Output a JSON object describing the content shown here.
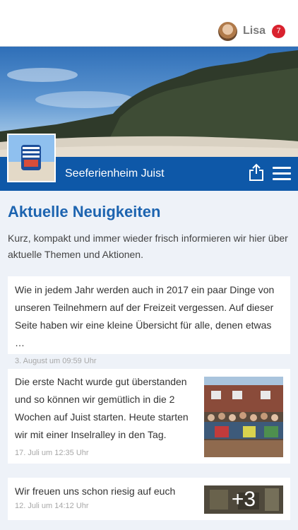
{
  "header": {
    "username": "Lisa",
    "notification_count": "7"
  },
  "site": {
    "name": "Seeferienheim Juist"
  },
  "main": {
    "section_title": "Aktuelle Neuigkeiten",
    "intro": "Kurz, kompakt und immer wieder frisch informieren wir hier über aktuelle Themen und Aktionen."
  },
  "posts": [
    {
      "text": "Wie in jedem Jahr werden auch in 2017 ein paar Dinge von unseren Teilnehmern auf der Freizeit vergessen. Auf dieser Seite haben wir eine kleine Übersicht für alle, denen etwas …",
      "time": "3. August um 09:59 Uhr"
    },
    {
      "text": "Die erste Nacht wurde gut überstanden und so können wir gemütlich in die 2 Wochen auf Juist starten. Heute starten wir mit einer Inselralley in den Tag.",
      "time": "17. Juli um 12:35 Uhr"
    },
    {
      "text": "Wir freuen uns schon riesig auf euch",
      "time": "12. Juli um 14:12 Uhr",
      "more_images": "+3"
    }
  ],
  "colors": {
    "brand": "#0e58a8",
    "title": "#1d64b0",
    "badge": "#d9222e",
    "background": "#eef2f8"
  }
}
